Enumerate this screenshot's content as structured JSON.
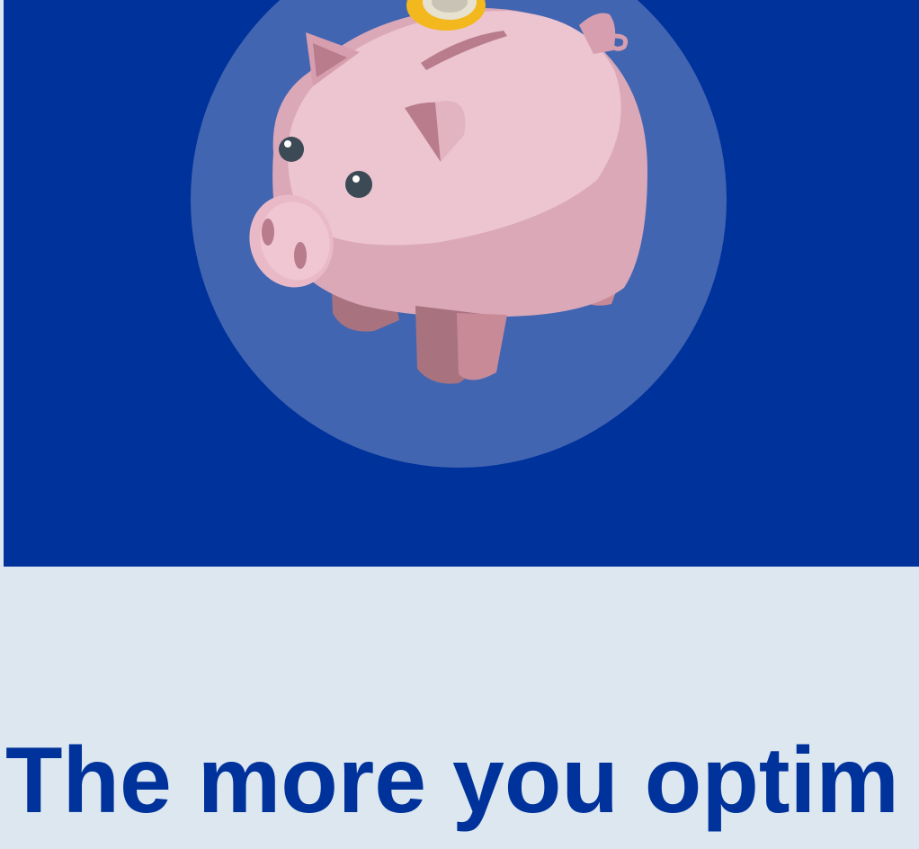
{
  "hero": {
    "illustration_icon": "piggy-bank-icon",
    "coin_icon": "coin-icon",
    "background_color": "#00329b",
    "circle_color": "#4265b1"
  },
  "content": {
    "headline": "The more you optim",
    "text_color": "#00329b",
    "background_color": "#dce7f0"
  }
}
